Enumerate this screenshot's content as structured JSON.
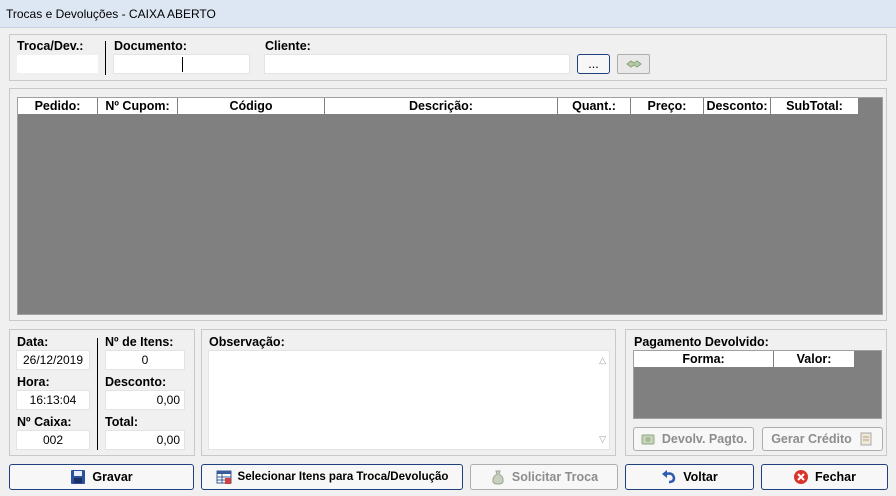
{
  "window": {
    "title": "Trocas e Devoluções - CAIXA ABERTO"
  },
  "top": {
    "troca_label": "Troca/Dev.:",
    "documento_label": "Documento:",
    "cliente_label": "Cliente:",
    "browse_label": "..."
  },
  "grid": {
    "columns": [
      "Pedido:",
      "Nº Cupom:",
      "Código",
      "Descrição:",
      "Quant.:",
      "Preço:",
      "Desconto:",
      "SubTotal:"
    ]
  },
  "info": {
    "data_label": "Data:",
    "data_value": "26/12/2019",
    "hora_label": "Hora:",
    "hora_value": "16:13:04",
    "caixa_label": "Nº Caixa:",
    "caixa_value": "002",
    "itens_label": "Nº de Itens:",
    "itens_value": "0",
    "desconto_label": "Desconto:",
    "desconto_value": "0,00",
    "total_label": "Total:",
    "total_value": "0,00"
  },
  "obs": {
    "label": "Observação:"
  },
  "pagamento": {
    "label": "Pagamento Devolvido:",
    "columns": [
      "Forma:",
      "Valor:"
    ],
    "devolv_label": "Devolv. Pagto.",
    "gerar_label": "Gerar Crédito"
  },
  "buttons": {
    "gravar": "Gravar",
    "selecionar": "Selecionar Itens para Troca/Devolução",
    "solicitar": "Solicitar Troca",
    "voltar": "Voltar",
    "fechar": "Fechar"
  },
  "colors": {
    "accent": "#1f3f7f",
    "grid_bg": "#808080",
    "titlebar": "#dde6f3"
  }
}
